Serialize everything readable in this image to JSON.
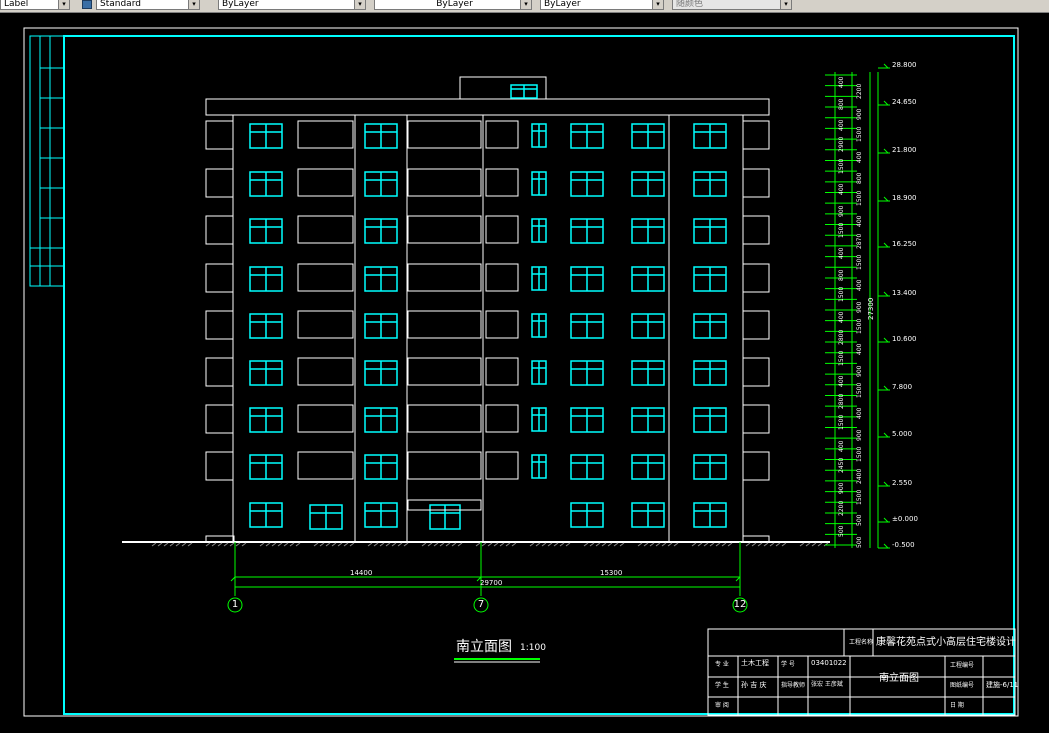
{
  "toolbar": {
    "text_style": "Label",
    "dim_style": "Standard",
    "layer": "ByLayer",
    "linetype": "ByLayer",
    "lineweight": "ByLayer",
    "plotstyle": "随颜色",
    "arrow": "▾"
  },
  "drawing": {
    "title": "南立面图",
    "scale": "1:100",
    "axes": {
      "left": "1",
      "middle": "7",
      "right": "12"
    },
    "dimensions": {
      "left_span": "14400",
      "right_span": "15300",
      "total": "29700"
    },
    "elevations": [
      "28.800",
      "24.650",
      "21.800",
      "18.900",
      "16.250",
      "13.400",
      "10.600",
      "7.800",
      "5.000",
      "2.550",
      "±0.000",
      "-0.500"
    ],
    "total_height": "27300",
    "segments": [
      "400",
      "2200",
      "800",
      "900",
      "400",
      "1500",
      "2900",
      "400",
      "1500",
      "800",
      "400",
      "1500",
      "900",
      "400",
      "1500",
      "2870",
      "400",
      "1500",
      "800",
      "400",
      "1500",
      "900",
      "400",
      "1500",
      "2800",
      "400",
      "1500",
      "900",
      "400",
      "1500",
      "2800",
      "400",
      "1500",
      "900",
      "400",
      "1500",
      "2450",
      "2400",
      "900",
      "1500",
      "2200",
      "500",
      "500",
      "500"
    ]
  },
  "title_block": {
    "project_label": "工程名称",
    "project_name": "康馨花苑点式小高层住宅楼设计",
    "major_label": "专 业",
    "major_value": "土木工程",
    "student_id_label": "学 号",
    "student_id_value": "03401022",
    "student_label": "学 生",
    "student_value": "孙 吉 庆",
    "advisor_label": "指导教师",
    "advisor_value": "张宏  王彦斌",
    "drawing_name": "南立面图",
    "number_label": "工程编号",
    "drawing_no_label": "图纸编号",
    "drawing_no_value": "建施-6/11",
    "review_label": "审 阅",
    "date_label": "日 期"
  },
  "colors": {
    "cyan": "#00ffff",
    "white": "#ffffff",
    "green": "#00ff00",
    "background": "#000000"
  }
}
